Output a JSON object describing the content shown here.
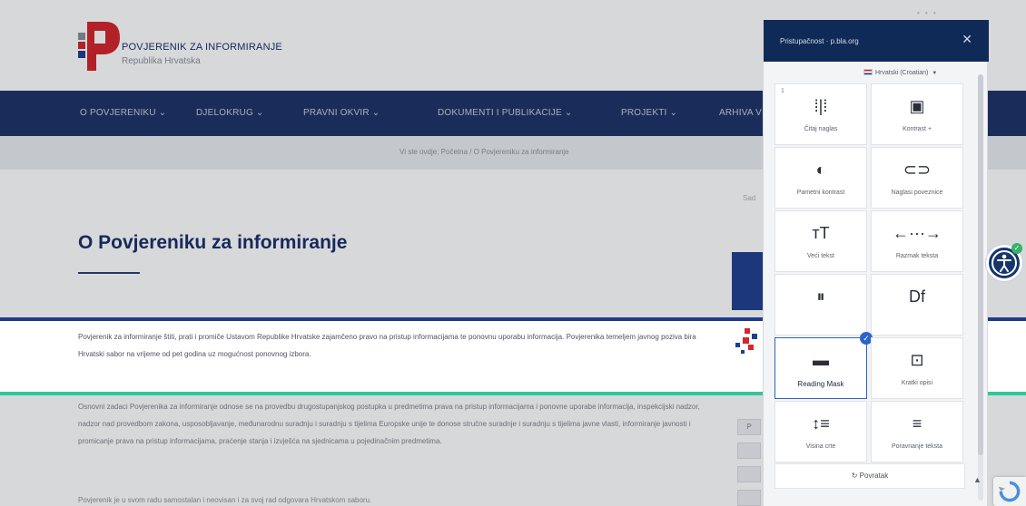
{
  "header": {
    "brand_title": "POVJERENIK ZA INFORMIRANJE",
    "brand_sub": "Republika Hrvatska"
  },
  "nav": {
    "items": [
      {
        "label": "O POVJERENIKU ⌄"
      },
      {
        "label": "DJELOKRUG ⌄"
      },
      {
        "label": "PRAVNI OKVIR ⌄"
      },
      {
        "label": "DOKUMENTI I PUBLIKACIJE ⌄"
      },
      {
        "label": "PROJEKTI ⌄"
      },
      {
        "label": "ARHIVA V"
      }
    ]
  },
  "breadcrumb": "Vi ste ovdje: Početna / O Povjereniku za informiranje",
  "main": {
    "title": "O Povjereniku za informiranje",
    "search_fragment": "Sad",
    "paragraphs": [
      "Povjerenik za informiranje štiti, prati i promiče Ustavom Republike Hrvatske zajamčeno pravo na pristup informacijama te ponovnu uporabu informacija. Povjerenika temeljem javnog poziva bira Hrvatski sabor na vrijeme od pet godina uz mogućnost ponovnog izbora.",
      "Osnovni zadaci Povjerenika za informiranje odnose se na provedbu drugostupanjskog postupka u predmetima prava na pristup informacijama i ponovne uporabe informacija, inspekcijski nadzor, nadzor nad provedbom zakona, usposobljavanje, međunarodnu suradnju i suradnju s tijelima Europske unije te donose stručne suradnje i suradnju s tijelima javne vlasti, informiranje javnosti i promicanje prava na pristup informacijama, praćenje stanja i izvješća na sjednicama u pojedinačnim predmetima.",
      "Povjerenik je u svom radu samostalan i neovisan i za svoj rad odgovara Hrvatskom saboru."
    ],
    "side_slots": [
      "P",
      "",
      "",
      "",
      ""
    ]
  },
  "panel": {
    "title": "Pristupačnost · p.bla.org",
    "close_icon": "close-icon",
    "language": "Hrvatski (Croatian)",
    "tiles": [
      {
        "name": "tile-read-aloud",
        "icon": "audio-wave-icon",
        "glyph": "⁞|⁞",
        "label": "Čitaj naglas",
        "num": "1"
      },
      {
        "name": "tile-contrast-plus",
        "icon": "monitor-icon",
        "glyph": "▣",
        "label": "Kontrast +",
        "num": ""
      },
      {
        "name": "tile-smart-contrast",
        "icon": "contrast-icon",
        "glyph": "◐",
        "label": "Pametni kontrast",
        "num": ""
      },
      {
        "name": "tile-highlight-links",
        "icon": "link-icon",
        "glyph": "⊂⊃",
        "label": "Naglasi poveznice",
        "num": ""
      },
      {
        "name": "tile-bigger-text",
        "icon": "text-size-icon",
        "glyph": "ᴛT",
        "label": "Veći tekst",
        "num": ""
      },
      {
        "name": "tile-text-spacing",
        "icon": "spacing-icon",
        "glyph": "←···→",
        "label": "Razmak teksta",
        "num": ""
      },
      {
        "name": "tile-pause-animations",
        "icon": "pause-icon",
        "glyph": "⏸",
        "label": "",
        "num": ""
      },
      {
        "name": "tile-dyslexia",
        "icon": "dyslexia-font-icon",
        "glyph": "Df",
        "label": "",
        "num": ""
      },
      {
        "name": "tile-reading-mask",
        "icon": "reading-mask-icon",
        "glyph": "▬",
        "label": "Reading Mask",
        "num": "",
        "active": true
      },
      {
        "name": "tile-tooltips",
        "icon": "tooltip-icon",
        "glyph": "⊡",
        "label": "Kratki opisi",
        "num": ""
      },
      {
        "name": "tile-line-height",
        "icon": "line-height-icon",
        "glyph": "↕≡",
        "label": "Visina crte",
        "num": ""
      },
      {
        "name": "tile-text-align",
        "icon": "align-icon",
        "glyph": "≡",
        "label": "Poravnanje teksta",
        "num": ""
      }
    ],
    "reset_label": "Povratak",
    "reset_icon": "reset-icon"
  },
  "colors": {
    "nav_bg": "#1e3468",
    "panel_header": "#0f2a57",
    "accent": "#2e63c8",
    "mask_top": "#1f3a8d",
    "mask_bottom": "#2fc79b",
    "title": "#1b2f6b"
  },
  "widgets": {
    "accessibility_button_icon": "accessibility-icon",
    "recaptcha_icon": "recaptcha-icon",
    "top_dots": "• • •"
  }
}
